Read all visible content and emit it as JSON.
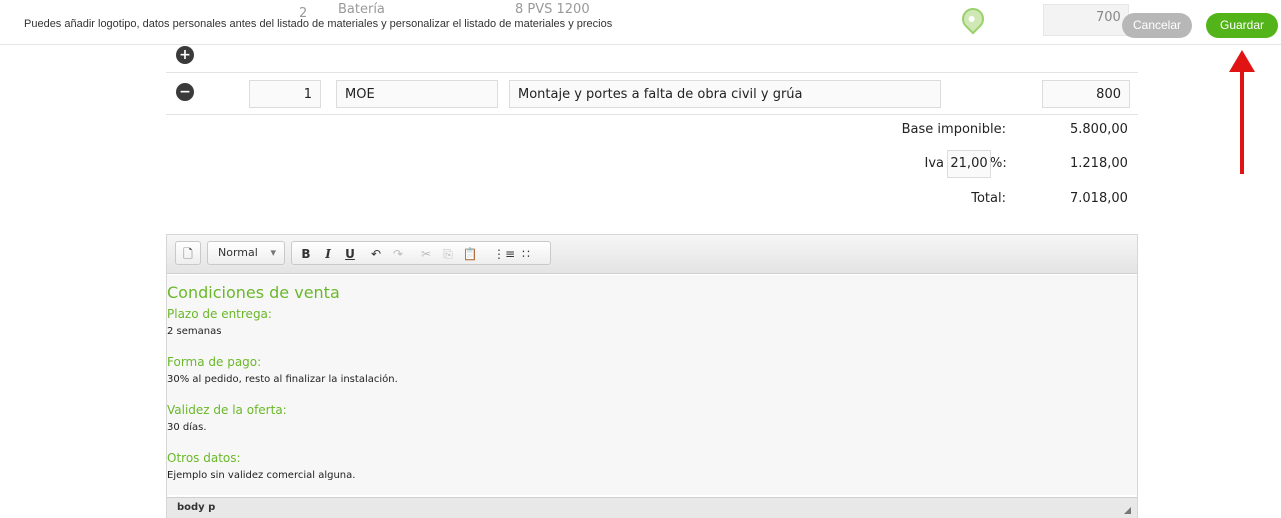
{
  "topbar": {
    "hint": "Puedes añadir logotipo, datos personales antes del listado de materiales y personalizar el listado de materiales y precios",
    "ghost_row": {
      "qty": "2",
      "name": "Batería",
      "desc": "8 PVS 1200",
      "price": "700"
    },
    "cancel_label": "Cancelar",
    "save_label": "Guardar",
    "colors": {
      "save": "#53b41a",
      "cancel": "#b7b7b7"
    }
  },
  "line_item": {
    "qty": "1",
    "code": "MOE",
    "description": "Montaje y portes a falta de obra civil y grúa",
    "price": "800"
  },
  "totals": {
    "base_label": "Base imponible:",
    "base_value": "5.800,00",
    "iva_label": "Iva",
    "iva_rate": "21,00",
    "iva_pct": "%:",
    "iva_value": "1.218,00",
    "total_label": "Total:",
    "total_value": "7.018,00"
  },
  "editor": {
    "format_value": "Normal",
    "toolbar_icons": [
      "new-page-icon",
      "bold-icon",
      "italic-icon",
      "underline-icon",
      "undo-icon",
      "redo-icon",
      "cut-icon",
      "copy-icon",
      "paste-icon",
      "numbered-list-icon",
      "bulleted-list-icon"
    ],
    "heading": "Condiciones de venta",
    "sections": [
      {
        "title": "Plazo de entrega:",
        "text": "2 semanas"
      },
      {
        "title": "Forma de pago:",
        "text": "30% al pedido, resto al finalizar la instalación."
      },
      {
        "title": "Validez de la oferta:",
        "text": "30 días."
      },
      {
        "title": "Otros datos:",
        "text": "Ejemplo sin validez comercial alguna."
      }
    ],
    "path": "body  p"
  },
  "annotation": {
    "color": "#e11414"
  }
}
